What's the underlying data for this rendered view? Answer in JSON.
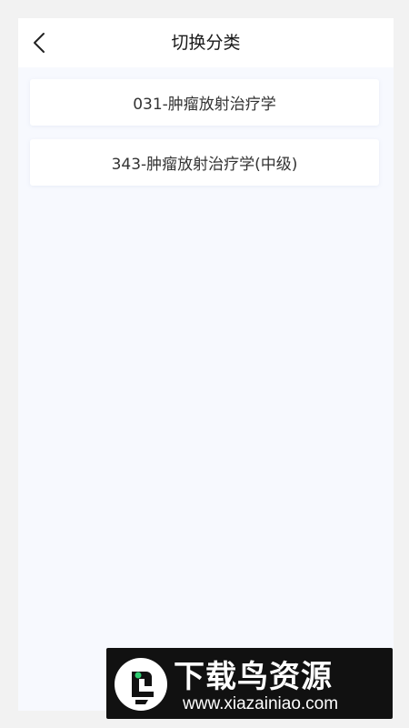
{
  "header": {
    "title": "切换分类",
    "back_icon": "chevron-left-icon"
  },
  "categories": [
    {
      "label": "031-肿瘤放射治疗学"
    },
    {
      "label": "343-肿瘤放射治疗学(中级)"
    }
  ],
  "watermark": {
    "title": "下载鸟资源",
    "url": "www.xiazainiao.com",
    "logo_icon": "bird-logo-icon"
  },
  "colors": {
    "page_background": "#f7f9fe",
    "header_background": "#ffffff",
    "card_background": "#ffffff",
    "text_primary": "#333333",
    "logo_accent": "#2ecc71"
  }
}
